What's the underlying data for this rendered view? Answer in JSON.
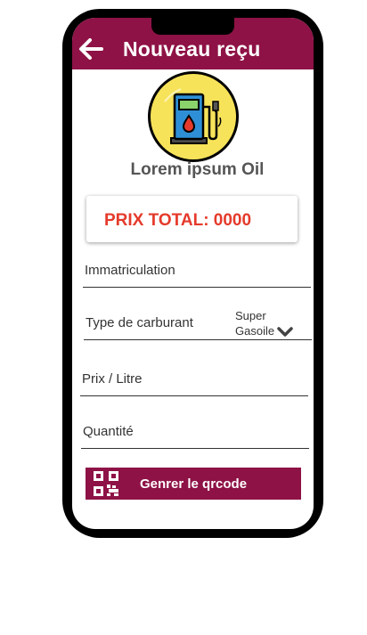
{
  "appbar": {
    "title": "Nouveau reçu",
    "back_icon": "arrow-left-icon"
  },
  "station": {
    "name": "Lorem ipsum Oil",
    "logo_icon": "gas-pump-icon"
  },
  "total": {
    "label": "PRIX TOTAL: 0000"
  },
  "form": {
    "immatriculation": {
      "label": "Immatriculation"
    },
    "fuel_type": {
      "label": "Type de carburant",
      "options": [
        "Super",
        "Gasoile"
      ],
      "icon": "chevron-down-icon"
    },
    "price_per_litre": {
      "label": "Prix / Litre"
    },
    "quantity": {
      "label": "Quantité"
    }
  },
  "action": {
    "label": "Genrer le qrcode",
    "icon": "qrcode-icon"
  },
  "colors": {
    "primary": "#8e1246",
    "total_text": "#e53a2b",
    "logo_bg": "#f7e35a",
    "frame": "#000000"
  }
}
